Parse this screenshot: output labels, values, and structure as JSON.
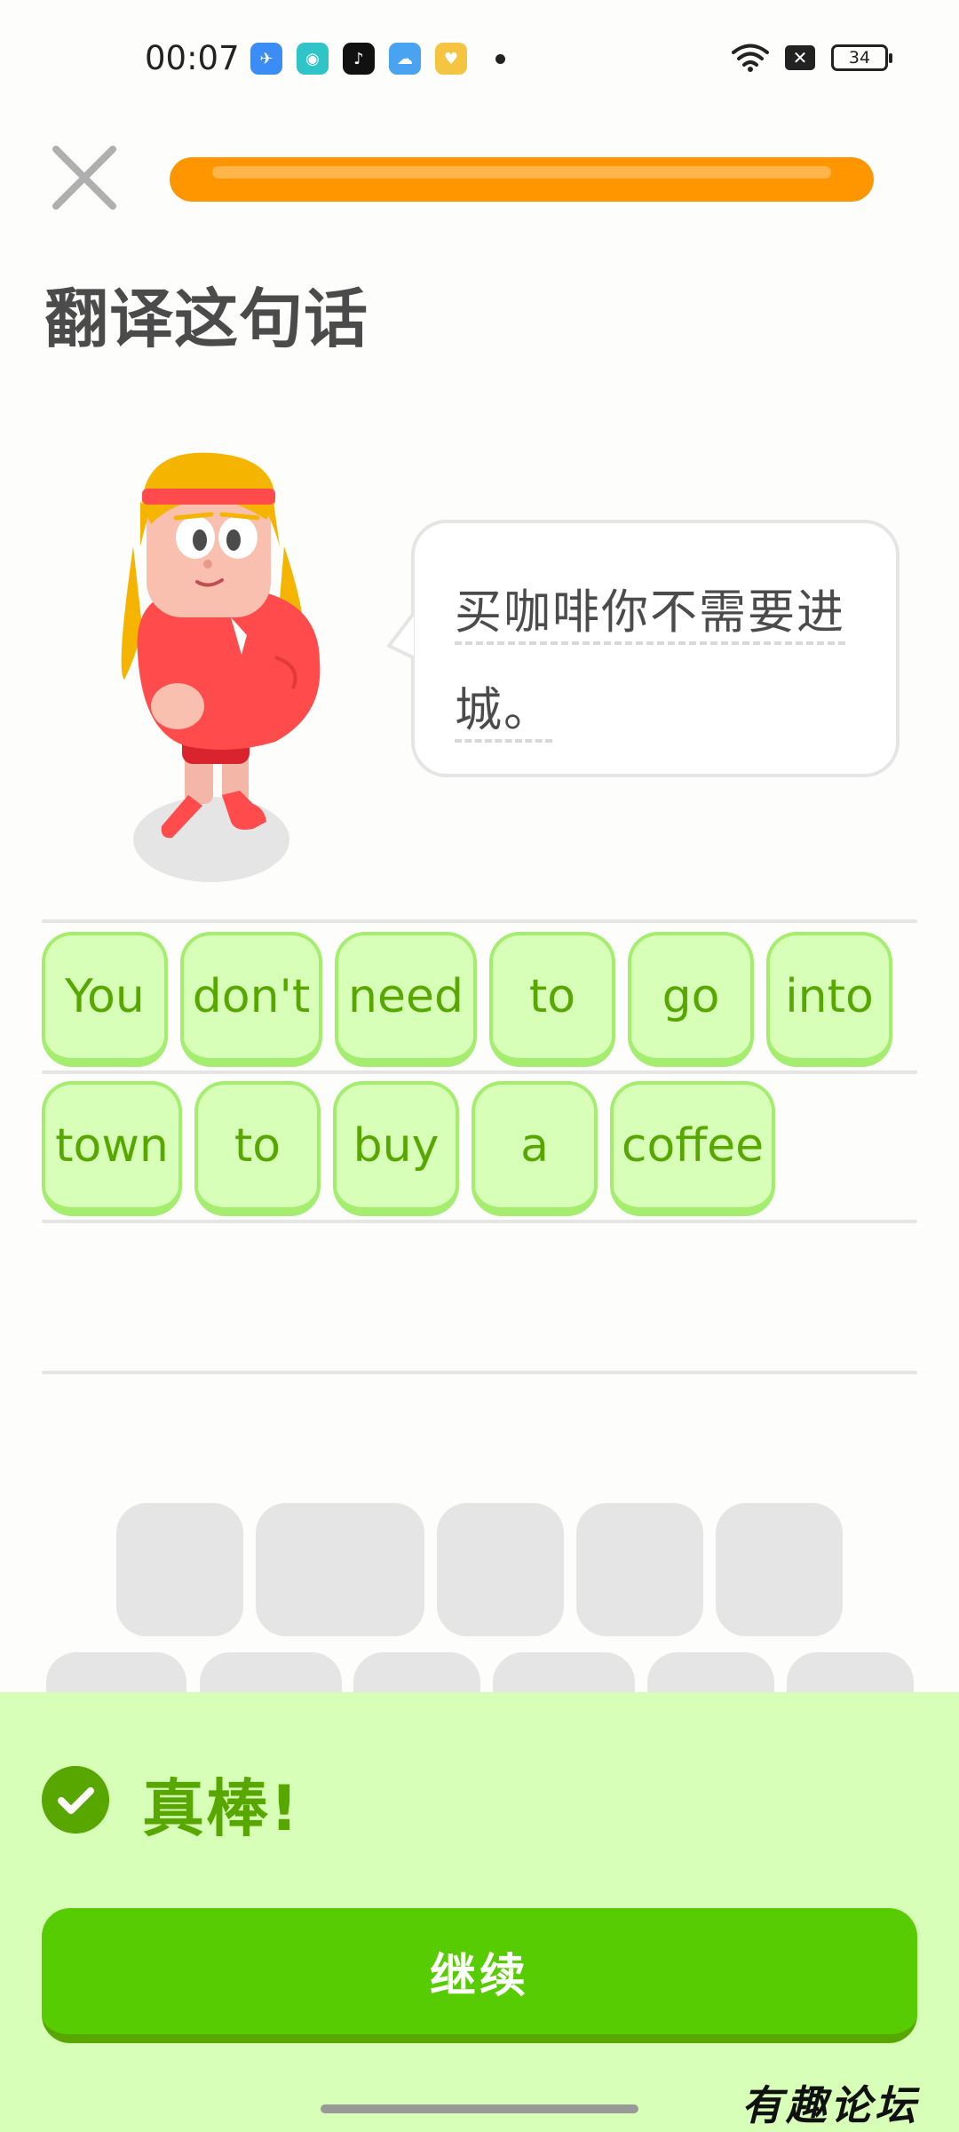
{
  "status_bar": {
    "time": "00:07",
    "battery": "34",
    "apps": [
      "feishu-icon",
      "magic-icon",
      "tiktok-icon",
      "weather-icon",
      "favorites-icon"
    ]
  },
  "progress": {
    "fraction": 1.0
  },
  "prompt": {
    "title": "翻译这句话"
  },
  "speech_bubble": {
    "line1": "买咖啡你不需要进",
    "line2": "城。"
  },
  "answer": {
    "row1": [
      "You",
      "don't",
      "need",
      "to",
      "go",
      "into"
    ],
    "row2": [
      "town",
      "to",
      "buy",
      "a",
      "coffee"
    ]
  },
  "feedback": {
    "message": "真棒!",
    "continue_label": "继续"
  },
  "watermark": {
    "text": "有趣论坛"
  },
  "colors": {
    "accent_green": "#58CC02",
    "dark_green": "#58A700",
    "chip_bg": "#D7FFB8",
    "chip_border": "#A5ED6E",
    "progress_orange": "#FF9600",
    "gray": "#E5E5E5"
  }
}
